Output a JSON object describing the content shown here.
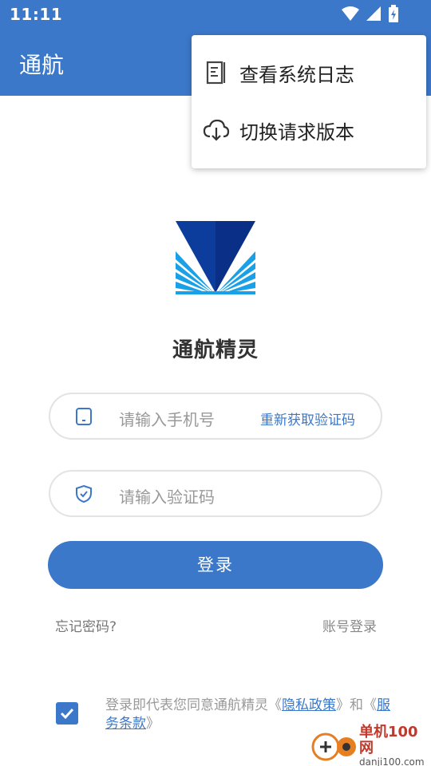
{
  "status_bar": {
    "time": "11:11"
  },
  "app_bar": {
    "title": "通航"
  },
  "overflow_menu": {
    "items": [
      {
        "label": "查看系统日志",
        "icon": "log-document-icon"
      },
      {
        "label": "切换请求版本",
        "icon": "cloud-download-icon"
      }
    ]
  },
  "app_name": "通航精灵",
  "phone_field": {
    "placeholder": "请输入手机号",
    "action_label": "重新获取验证码",
    "icon": "phone-icon"
  },
  "code_field": {
    "placeholder": "请输入验证码",
    "icon": "shield-check-icon"
  },
  "login_button": {
    "label": "登录"
  },
  "links": {
    "forgot": "忘记密码?",
    "account_login": "账号登录"
  },
  "agreement": {
    "checked": true,
    "prefix": "登录即代表您同意通航精灵《",
    "privacy_policy": "隐私政策",
    "middle": "》和《",
    "terms": "服务条款",
    "suffix": "》"
  },
  "watermark": {
    "line1": "单机100网",
    "line2": "danji100.com"
  },
  "colors": {
    "primary": "#3b78c9",
    "logo_dark": "#0d3d9c",
    "logo_light": "#1aa0e6"
  }
}
